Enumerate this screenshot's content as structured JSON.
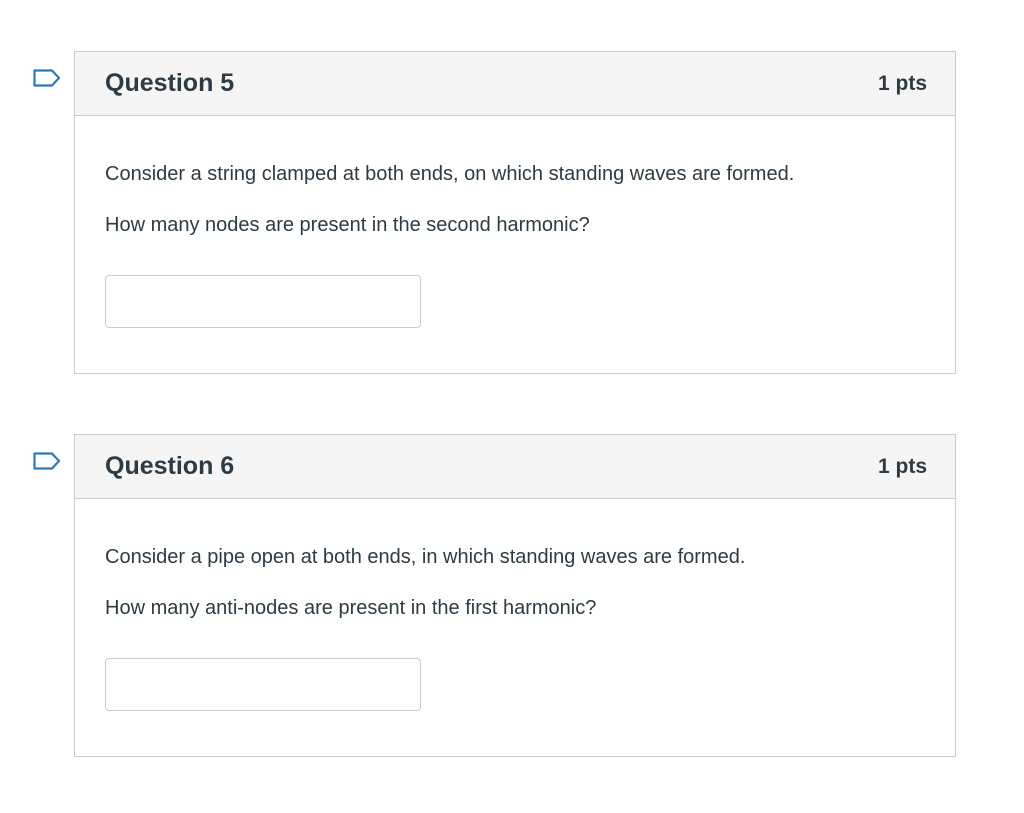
{
  "questions": [
    {
      "title": "Question 5",
      "points": "1 pts",
      "prompt": "Consider a string clamped at both ends, on which standing waves are formed.",
      "question": "How many nodes are present in the second harmonic?",
      "answer_value": "",
      "flag_icon": "flag-outline-icon"
    },
    {
      "title": "Question 6",
      "points": "1 pts",
      "prompt": "Consider a pipe open at both ends, in which standing waves are formed.",
      "question": "How many anti-nodes are present in the first harmonic?",
      "answer_value": "",
      "flag_icon": "flag-outline-icon"
    }
  ],
  "colors": {
    "flag": "#2b7abc",
    "border": "#c7cdd1",
    "header_bg": "#f5f5f5",
    "text": "#2d3b45"
  }
}
